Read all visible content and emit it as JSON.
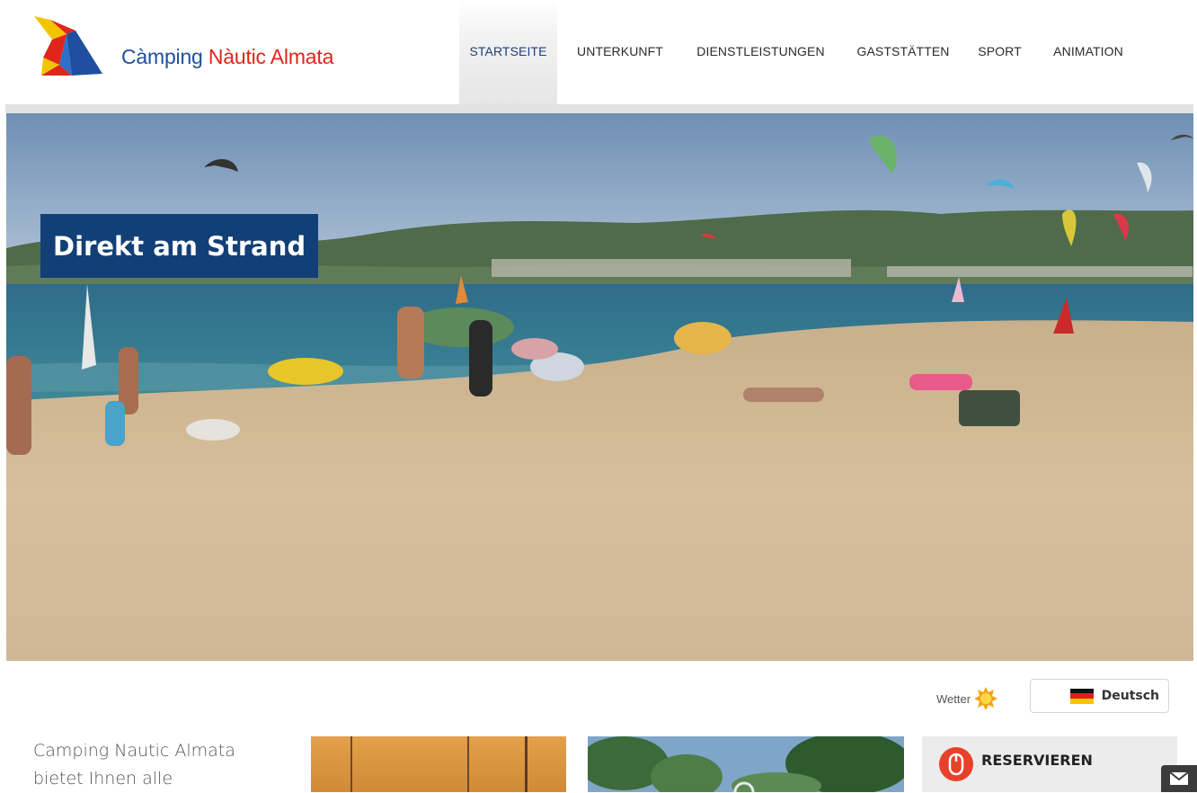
{
  "header": {
    "brand_part1": "Càmping",
    "brand_part2": "Nàutic Almata"
  },
  "nav": {
    "items": [
      {
        "label": "STARTSEITE",
        "active": true
      },
      {
        "label": "UNTERKUNFT",
        "active": false
      },
      {
        "label": "DIENSTLEISTUNGEN",
        "active": false
      },
      {
        "label": "GASTSTÄTTEN",
        "active": false
      },
      {
        "label": "SPORT",
        "active": false
      },
      {
        "label": "ANIMATION",
        "active": false
      }
    ]
  },
  "hero": {
    "caption": "Direkt am Strand"
  },
  "utility": {
    "weather_label": "Wetter",
    "weather_icon": "sun-icon",
    "language_label": "Deutsch",
    "language_icon": "german-flag-icon"
  },
  "content": {
    "intro_line1": "Camping Nautic Almata",
    "intro_line2": "bietet Ihnen alle"
  },
  "reserve": {
    "label": "RESERVIEREN",
    "icon": "mouse-icon"
  },
  "mail": {
    "icon": "envelope-icon"
  },
  "colors": {
    "brand_blue": "#1f4f9e",
    "brand_red": "#e0251b",
    "nav_active": "#0e3766",
    "caption_bg": "#123f76",
    "reserve_icon": "#e8402a"
  }
}
